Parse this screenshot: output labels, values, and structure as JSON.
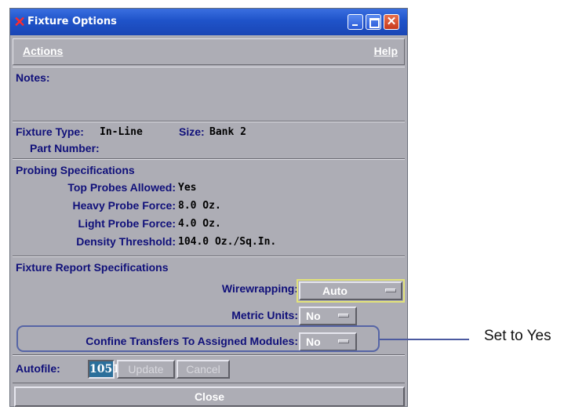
{
  "window": {
    "title": "Fixture Options"
  },
  "menu": {
    "actions": "Actions",
    "help": "Help"
  },
  "notes": {
    "label": "Notes:"
  },
  "fixture": {
    "type_label": "Fixture Type:",
    "type_value": "In-Line",
    "size_label": "Size:",
    "size_value": "Bank 2",
    "part_label": "Part Number:"
  },
  "probing": {
    "heading": "Probing Specifications",
    "rows": [
      {
        "label": "Top Probes Allowed:",
        "value": "Yes"
      },
      {
        "label": "Heavy Probe Force:",
        "value": "8.0 Oz."
      },
      {
        "label": "Light Probe Force:",
        "value": "4.0 Oz."
      },
      {
        "label": "Density Threshold:",
        "value": "104.0 Oz./Sq.In."
      }
    ]
  },
  "report": {
    "heading": "Fixture Report Specifications",
    "wirewrapping_label": "Wirewrapping:",
    "wirewrapping_value": "Auto",
    "metric_label": "Metric Units:",
    "metric_value": "No",
    "confine_label": "Confine Transfers To Assigned Modules:",
    "confine_value": "No"
  },
  "autofile": {
    "label": "Autofile:",
    "value": "1051",
    "update": "Update",
    "cancel": "Cancel"
  },
  "close": {
    "label": "Close"
  },
  "annotation": {
    "text": "Set to Yes"
  },
  "colors": {
    "title_bar": "#1f53c9",
    "label_text": "#10107a",
    "panel": "#adadb5",
    "focus": "#e2e27a",
    "callout": "#5665a6"
  }
}
